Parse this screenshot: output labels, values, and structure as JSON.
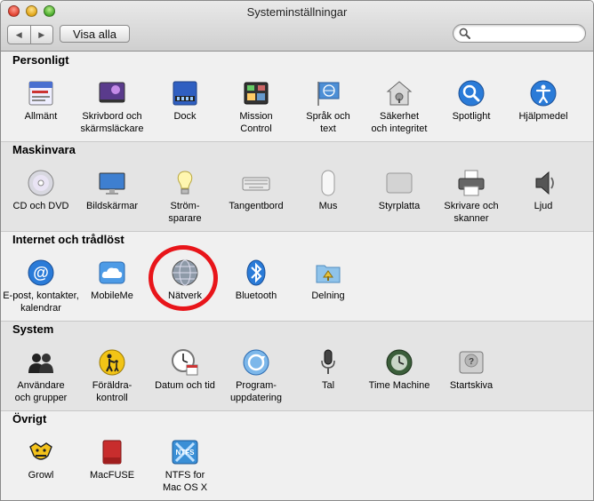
{
  "window": {
    "title": "Systeminställningar"
  },
  "toolbar": {
    "back_label": "◀",
    "forward_label": "▶",
    "show_all_label": "Visa alla",
    "search_value": ""
  },
  "sections": [
    {
      "title": "Personligt",
      "items": [
        {
          "label": "Allmänt",
          "icon": "general-icon"
        },
        {
          "label": "Skrivbord och\nskärmsläckare",
          "icon": "desktop-icon"
        },
        {
          "label": "Dock",
          "icon": "dock-icon"
        },
        {
          "label": "Mission\nControl",
          "icon": "mission-control-icon"
        },
        {
          "label": "Språk och\ntext",
          "icon": "language-flag-icon"
        },
        {
          "label": "Säkerhet\noch integritet",
          "icon": "security-house-icon"
        },
        {
          "label": "Spotlight",
          "icon": "spotlight-icon"
        },
        {
          "label": "Hjälpmedel",
          "icon": "accessibility-icon"
        }
      ]
    },
    {
      "title": "Maskinvara",
      "items": [
        {
          "label": "CD och DVD",
          "icon": "cd-icon"
        },
        {
          "label": "Bildskärmar",
          "icon": "display-icon"
        },
        {
          "label": "Ström-\nsparare",
          "icon": "lightbulb-icon"
        },
        {
          "label": "Tangentbord",
          "icon": "keyboard-icon"
        },
        {
          "label": "Mus",
          "icon": "mouse-icon"
        },
        {
          "label": "Styrplatta",
          "icon": "trackpad-icon"
        },
        {
          "label": "Skrivare och\nskanner",
          "icon": "printer-icon"
        },
        {
          "label": "Ljud",
          "icon": "speaker-icon"
        }
      ]
    },
    {
      "title": "Internet och trådlöst",
      "items": [
        {
          "label": "E-post, kontakter,\nkalendrar",
          "icon": "at-icon"
        },
        {
          "label": "MobileMe",
          "icon": "cloud-icon"
        },
        {
          "label": "Nätverk",
          "icon": "network-globe-icon"
        },
        {
          "label": "Bluetooth",
          "icon": "bluetooth-icon"
        },
        {
          "label": "Delning",
          "icon": "sharing-folder-icon"
        }
      ]
    },
    {
      "title": "System",
      "items": [
        {
          "label": "Användare\noch grupper",
          "icon": "users-icon"
        },
        {
          "label": "Föräldra-\nkontroll",
          "icon": "parental-icon"
        },
        {
          "label": "Datum och tid",
          "icon": "clock-icon"
        },
        {
          "label": "Program-\nuppdatering",
          "icon": "software-update-icon"
        },
        {
          "label": "Tal",
          "icon": "microphone-icon"
        },
        {
          "label": "Time Machine",
          "icon": "time-machine-icon"
        },
        {
          "label": "Startskiva",
          "icon": "startup-disk-icon"
        }
      ]
    },
    {
      "title": "Övrigt",
      "items": [
        {
          "label": "Growl",
          "icon": "growl-icon"
        },
        {
          "label": "MacFUSE",
          "icon": "macfuse-icon"
        },
        {
          "label": "NTFS for\nMac OS X",
          "icon": "ntfs-icon"
        }
      ]
    }
  ]
}
